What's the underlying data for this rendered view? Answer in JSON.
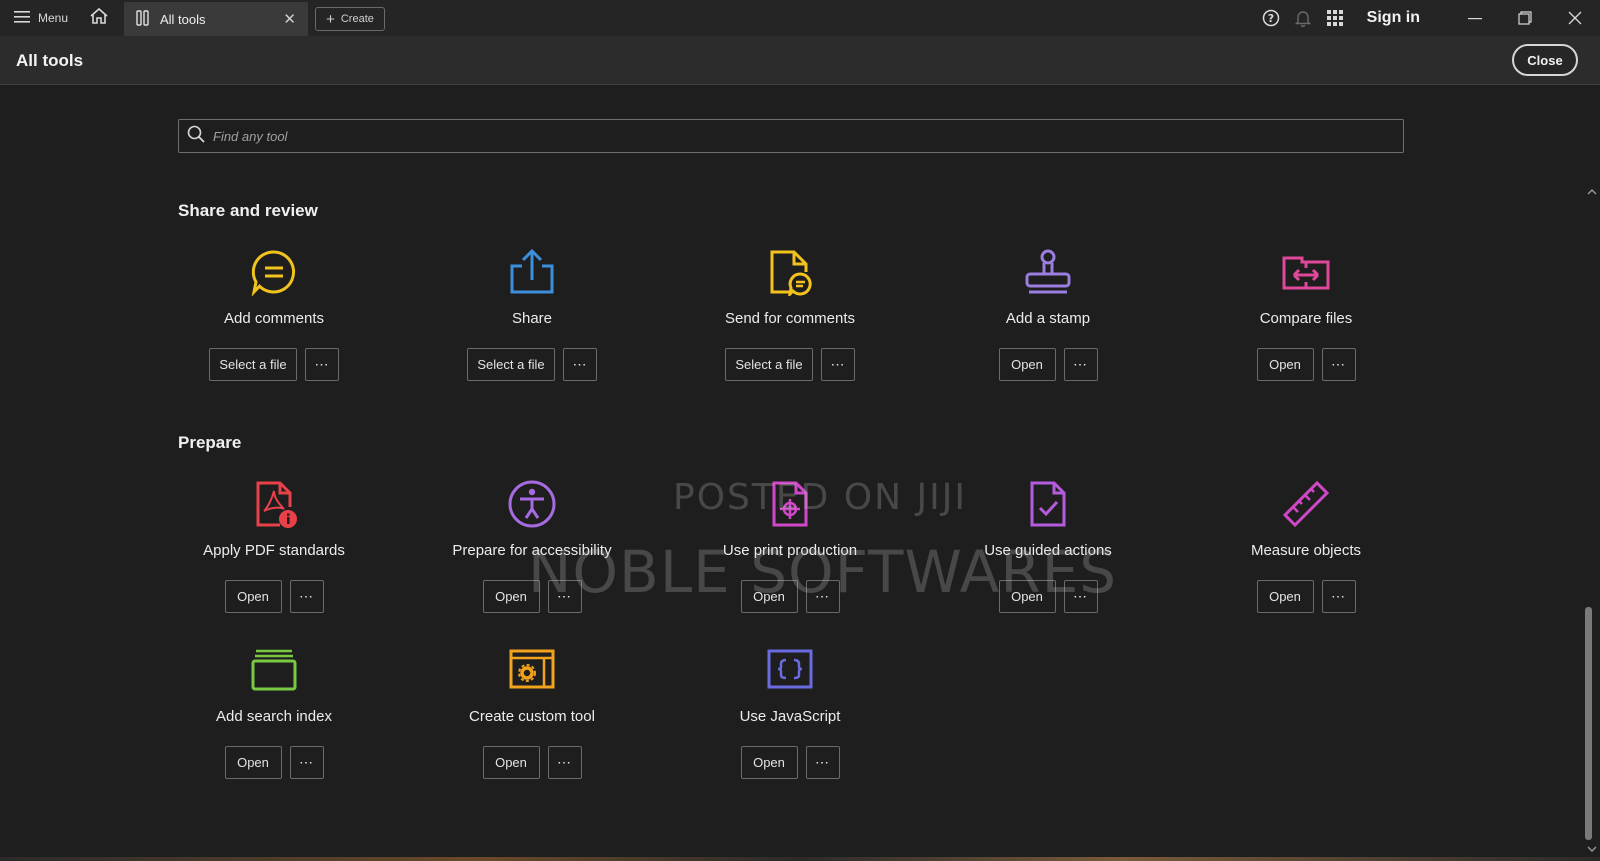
{
  "titlebar": {
    "menu_label": "Menu",
    "tab_label": "All tools",
    "tab_close": "✕",
    "create_label": "Create",
    "sign_in": "Sign in"
  },
  "header": {
    "title": "All tools",
    "close_label": "Close"
  },
  "search": {
    "placeholder": "Find any tool"
  },
  "sections": {
    "share_review": {
      "title": "Share and review",
      "tools": [
        {
          "name": "Add comments",
          "action": "Select a file",
          "icon": "comment-icon",
          "color": "#f2c31d"
        },
        {
          "name": "Share",
          "action": "Select a file",
          "icon": "share-icon",
          "color": "#3b8fdb"
        },
        {
          "name": "Send for comments",
          "action": "Select a file",
          "icon": "send-comments-icon",
          "color": "#f2c31d"
        },
        {
          "name": "Add a stamp",
          "action": "Open",
          "icon": "stamp-icon",
          "color": "#9b7fe0"
        },
        {
          "name": "Compare files",
          "action": "Open",
          "icon": "compare-icon",
          "color": "#e0489a"
        }
      ]
    },
    "prepare": {
      "title": "Prepare",
      "tools": [
        {
          "name": "Apply PDF standards",
          "action": "Open",
          "icon": "pdf-standards-icon",
          "color": "#e8414a"
        },
        {
          "name": "Prepare for accessibility",
          "action": "Open",
          "icon": "accessibility-icon",
          "color": "#a66be0"
        },
        {
          "name": "Use print production",
          "action": "Open",
          "icon": "print-production-icon",
          "color": "#d048c8"
        },
        {
          "name": "Use guided actions",
          "action": "Open",
          "icon": "guided-actions-icon",
          "color": "#b55cde"
        },
        {
          "name": "Measure objects",
          "action": "Open",
          "icon": "ruler-icon",
          "color": "#d048c8"
        },
        {
          "name": "Add search index",
          "action": "Open",
          "icon": "search-index-icon",
          "color": "#7ac943"
        },
        {
          "name": "Create custom tool",
          "action": "Open",
          "icon": "custom-tool-icon",
          "color": "#f2a21d"
        },
        {
          "name": "Use JavaScript",
          "action": "Open",
          "icon": "javascript-icon",
          "color": "#6b6be0"
        }
      ]
    }
  },
  "more_label": "⋯",
  "watermark": {
    "line1": "POSTED ON JIJI",
    "line2": "NOBLE SOFTWARES"
  }
}
